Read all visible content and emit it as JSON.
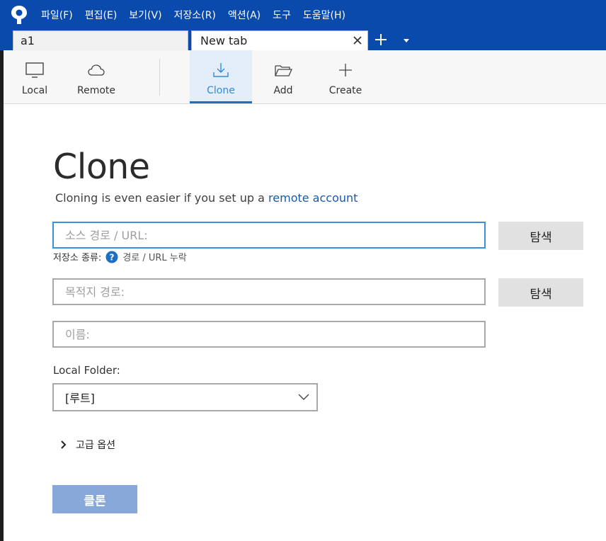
{
  "menu": {
    "items": [
      "파일(F)",
      "편집(E)",
      "보기(V)",
      "저장소(R)",
      "액션(A)",
      "도구",
      "도움말(H)"
    ]
  },
  "tabs": {
    "items": [
      {
        "label": "a1"
      },
      {
        "label": "New tab"
      }
    ]
  },
  "toolbar": {
    "local": "Local",
    "remote": "Remote",
    "clone": "Clone",
    "add": "Add",
    "create": "Create",
    "active": "clone"
  },
  "clone": {
    "title": "Clone",
    "subtitle_prefix": "Cloning is even easier if you set up a ",
    "subtitle_link": "remote account",
    "source_placeholder": "소스 경로 / URL:",
    "browse_label": "탐색",
    "repo_type_label": "저장소 종류:",
    "repo_type_value": "경로 / URL 누락",
    "dest_placeholder": "목적지 경로:",
    "name_placeholder": "이름:",
    "local_folder_label": "Local Folder:",
    "local_folder_value": "[루트]",
    "advanced_label": "고급 옵션",
    "clone_button": "클론"
  },
  "colors": {
    "titlebar": "#0b4aad",
    "accent": "#1e6fc4",
    "primary_button_disabled": "#87a8d9",
    "focus_border": "#3a8fde"
  },
  "icons": [
    "app-logo-icon",
    "close-icon",
    "plus-icon",
    "chevron-down-icon",
    "monitor-icon",
    "cloud-icon",
    "download-icon",
    "folder-open-icon",
    "plus-icon",
    "question-icon",
    "chevron-right-icon"
  ]
}
